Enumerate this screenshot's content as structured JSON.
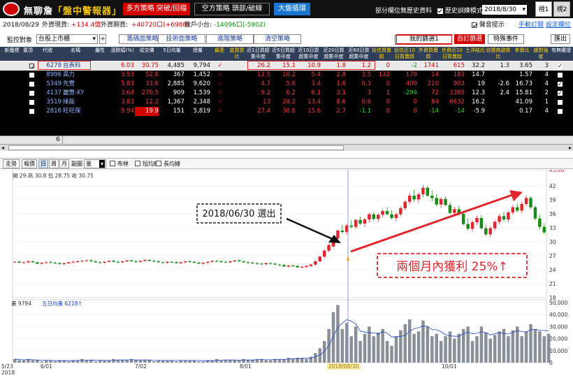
{
  "titlebar": {
    "app_name": "無聊詹",
    "app_subtitle": "「盤中警報器」",
    "btn_long": "多方策略 突破/回檔",
    "btn_short": "空方策略 頭部/破線",
    "btn_cycle": "大盤循環",
    "opt_store": "部分欄位無歷史資料",
    "opt_history": "歷史訓練模式",
    "date": "2018/8/30",
    "window1": "視1",
    "window2": "視2"
  },
  "infobar": {
    "date": "2018/08/29",
    "fx_spot_label": "外資現貨:",
    "fx_spot_value": "+134.4億",
    "fx_futures_label": "外資期貨:",
    "fx_futures_value": "+40720口(+6988)",
    "retail_label": "散戶小台:",
    "retail_value": "-14096口(-5902)",
    "opt_sound": "聲音提示",
    "link_manual": "手動訂閱",
    "link_settings": "設定欄位"
  },
  "toolbar2": {
    "monitor_label": "監控對象",
    "monitor_value": "台股上市櫃",
    "btn_chip": "籌碼面策略",
    "btn_tech": "技術面策略",
    "btn_advanced": "進階策略",
    "btn_clear": "清空策略",
    "my_screen": "我的篩選1",
    "custom_screen": "自訂篩選",
    "special_event": "特殊事件",
    "export": "匯出"
  },
  "table": {
    "headers": [
      "新獲標",
      "置頂",
      "代號",
      "名稱",
      "屬性",
      "漲跌幅(%)",
      "成交價",
      "5日均量",
      "總量",
      "最愛",
      "當買買比",
      "近1日買超集中度",
      "近5日買超集中度",
      "近10日買超集中度",
      "近20日買超集中度",
      "近60日買超集中度",
      "投信買賣超",
      "投信近10日買賣超",
      "外資買賣超",
      "外資近10日買賣超",
      "土洋結比",
      "自營商避險比",
      "參賣比",
      "趨勢強度",
      "有無權證"
    ],
    "rows": [
      {
        "code": "6278",
        "name": "台表科",
        "chg": "6.03",
        "price": "30.75",
        "vol5": "4,485",
        "vol": "9,794",
        "c1": "26.2",
        "c5": "15.1",
        "c10": "10.9",
        "c20": "1.8",
        "c60": "1.2",
        "it": "0",
        "it10": "-2",
        "fi": "1741",
        "fi10": "615",
        "ratio": "32.2",
        "hedge": "1.3",
        "sell": "3.65",
        "trend": "3",
        "warrant": true,
        "checked": true
      },
      {
        "code": "8996",
        "name": "高力",
        "chg": "3.53",
        "price": "52.8",
        "vol5": "367",
        "vol": "1,452",
        "c1": "11.5",
        "c5": "10.2",
        "c10": "5.4",
        "c20": "2.8",
        "c60": "3.5",
        "it": "132",
        "it10": "179",
        "fi": "14",
        "fi10": "183",
        "ratio": "14.7",
        "hedge": "",
        "sell": "1.57",
        "trend": "4",
        "warrant": false,
        "checked": false
      },
      {
        "code": "5349",
        "name": "先豐",
        "chg": "5.83",
        "price": "33.6",
        "vol5": "2,885",
        "vol": "9,620",
        "c1": "4.7",
        "c5": "5.6",
        "c10": "3.4",
        "c20": "1.6",
        "c60": "0.3",
        "it": "0",
        "it10": "409",
        "fi": "210",
        "fi10": "903",
        "ratio": "19",
        "hedge": "-2.6",
        "sell": "16.73",
        "trend": "4",
        "warrant": true,
        "checked": false
      },
      {
        "code": "4137",
        "name": "麗豐-KY",
        "chg": "3.64",
        "price": "270.5",
        "vol5": "909",
        "vol": "1,539",
        "c1": "9.2",
        "c5": "6.2",
        "c10": "6.1",
        "c20": "3.1",
        "c60": "3",
        "it": "1",
        "it10": "-294",
        "fi": "72",
        "fi10": "1385",
        "ratio": "12.3",
        "hedge": "2.4",
        "sell": "15.81",
        "trend": "2",
        "warrant": true,
        "checked": false
      },
      {
        "code": "3519",
        "name": "綠能",
        "chg": "3.83",
        "price": "12.2",
        "vol5": "1,367",
        "vol": "2,348",
        "c1": "13",
        "c5": "28.2",
        "c10": "13.4",
        "c20": "8.6",
        "c60": "0.6",
        "it": "0",
        "it10": "0",
        "fi": "84",
        "fi10": "6632",
        "ratio": "16.2",
        "hedge": "",
        "sell": "41.09",
        "trend": "1",
        "warrant": false,
        "checked": false
      },
      {
        "code": "2816",
        "name": "旺旺保",
        "chg": "9.94",
        "price": "19.9",
        "vol5": "151",
        "vol": "5,819",
        "c1": "27.4",
        "c5": "30.6",
        "c10": "15.6",
        "c20": "2.7",
        "c60": "-1.1",
        "it": "0",
        "it10": "0",
        "fi": "-14",
        "fi10": "-14",
        "ratio": "-5.9",
        "hedge": "",
        "sell": "0.17",
        "trend": "4",
        "warrant": false,
        "checked": false
      }
    ],
    "status_count": "6"
  },
  "chart_toolbar": {
    "tabs": [
      "走勢",
      "報價",
      "日",
      "周",
      "月"
    ],
    "sub_label": "副圖",
    "sub_value": "量",
    "opt_bollinger": "布林",
    "opt_short_ma": "短均線",
    "opt_long_ma": "長均線"
  },
  "chart_info": {
    "ohlc": "開 29 高 30.8 低 28.75 收 30.75",
    "vol_label": "量 9794",
    "vol_ma_label": "五日均量 6218↑"
  },
  "annotations": {
    "pick_label": "2018/06/30 選出",
    "profit_label": "兩個月內獲利 25%↑",
    "marker_date": "2018/08/30"
  },
  "chart_data": {
    "type": "candlestick",
    "price_axis": [
      18,
      21,
      24,
      27,
      30,
      33,
      36,
      39,
      42,
      45.46
    ],
    "volume_axis": [
      "0",
      "10,000",
      "20,000",
      "30,000",
      "40,000",
      "50,000"
    ],
    "x_labels": [
      "5/23\n2018",
      "6/01",
      "7/02",
      "8/01",
      "2018/08/30",
      "10/01"
    ],
    "max_price_label": "45.46",
    "candles": [
      [
        25.6,
        25.8,
        25.5,
        25.7
      ],
      [
        25.7,
        25.9,
        25.4,
        25.5
      ],
      [
        25.5,
        25.8,
        25.3,
        25.6
      ],
      [
        25.6,
        26.0,
        25.4,
        25.8
      ],
      [
        25.8,
        26.0,
        25.5,
        25.6
      ],
      [
        25.6,
        25.7,
        25.2,
        25.3
      ],
      [
        25.3,
        25.6,
        25.1,
        25.5
      ],
      [
        25.5,
        25.8,
        25.3,
        25.6
      ],
      [
        25.6,
        25.9,
        25.4,
        25.5
      ],
      [
        25.5,
        25.7,
        25.2,
        25.4
      ],
      [
        25.4,
        25.6,
        25.1,
        25.2
      ],
      [
        25.2,
        25.5,
        25.0,
        25.4
      ],
      [
        25.4,
        25.7,
        25.2,
        25.6
      ],
      [
        25.6,
        25.9,
        25.4,
        25.7
      ],
      [
        25.7,
        26.0,
        25.5,
        25.8
      ],
      [
        25.8,
        26.1,
        25.6,
        25.9
      ],
      [
        25.9,
        26.2,
        25.7,
        26.0
      ],
      [
        26.0,
        26.3,
        25.7,
        25.8
      ],
      [
        25.8,
        26.0,
        25.5,
        25.6
      ],
      [
        25.6,
        25.8,
        25.3,
        25.5
      ],
      [
        25.5,
        25.8,
        25.3,
        25.7
      ],
      [
        25.7,
        26.0,
        25.5,
        25.9
      ],
      [
        25.9,
        26.1,
        25.6,
        25.7
      ],
      [
        25.7,
        25.9,
        25.4,
        25.6
      ],
      [
        25.6,
        25.9,
        25.4,
        25.8
      ],
      [
        25.8,
        26.1,
        25.6,
        26.0
      ],
      [
        26.0,
        26.2,
        25.7,
        25.8
      ],
      [
        25.8,
        26.0,
        25.5,
        25.7
      ],
      [
        25.7,
        26.0,
        25.5,
        25.9
      ],
      [
        25.9,
        26.2,
        25.7,
        26.1
      ],
      [
        26.1,
        26.3,
        25.8,
        25.9
      ],
      [
        25.9,
        26.1,
        25.6,
        25.8
      ],
      [
        25.8,
        26.0,
        25.5,
        25.6
      ],
      [
        25.6,
        25.8,
        25.3,
        25.5
      ],
      [
        25.5,
        25.8,
        25.3,
        25.7
      ],
      [
        25.7,
        25.9,
        25.4,
        25.6
      ],
      [
        25.6,
        25.8,
        25.3,
        25.4
      ],
      [
        25.4,
        25.7,
        25.2,
        25.6
      ],
      [
        25.6,
        25.9,
        25.4,
        25.8
      ],
      [
        25.8,
        26.0,
        25.5,
        25.7
      ],
      [
        25.7,
        25.9,
        25.4,
        25.5
      ],
      [
        25.5,
        25.7,
        25.2,
        25.3
      ],
      [
        25.3,
        25.6,
        25.1,
        25.5
      ],
      [
        25.5,
        25.8,
        25.3,
        25.7
      ],
      [
        25.7,
        26.0,
        25.5,
        25.9
      ],
      [
        25.9,
        26.1,
        25.6,
        25.8
      ],
      [
        25.8,
        26.0,
        25.5,
        25.7
      ],
      [
        25.7,
        25.9,
        25.4,
        25.6
      ],
      [
        25.6,
        25.9,
        25.4,
        25.8
      ],
      [
        25.8,
        26.1,
        25.6,
        26.0
      ],
      [
        26.0,
        26.2,
        25.7,
        25.8
      ],
      [
        25.8,
        26.0,
        25.5,
        25.6
      ],
      [
        25.6,
        25.8,
        25.3,
        25.5
      ],
      [
        25.5,
        25.7,
        25.2,
        25.4
      ],
      [
        25.4,
        25.6,
        25.1,
        25.3
      ],
      [
        25.3,
        25.5,
        25.0,
        25.2
      ],
      [
        25.2,
        25.5,
        25.0,
        25.4
      ],
      [
        25.4,
        25.6,
        25.1,
        25.3
      ],
      [
        25.3,
        25.5,
        25.0,
        25.1
      ],
      [
        25.1,
        25.3,
        24.8,
        25.0
      ],
      [
        25.0,
        25.2,
        24.6,
        24.7
      ],
      [
        24.7,
        25.0,
        24.5,
        24.9
      ],
      [
        24.9,
        25.1,
        24.6,
        24.8
      ],
      [
        24.8,
        25.0,
        24.4,
        24.5
      ],
      [
        24.5,
        24.8,
        24.3,
        24.6
      ],
      [
        24.6,
        24.9,
        24.4,
        24.8
      ],
      [
        24.8,
        25.3,
        24.6,
        25.1
      ],
      [
        25.1,
        26.0,
        24.9,
        25.8
      ],
      [
        25.8,
        27.0,
        25.6,
        26.8
      ],
      [
        26.8,
        28.3,
        26.5,
        28.1
      ],
      [
        28.1,
        29.5,
        27.8,
        29.3
      ],
      [
        29.0,
        30.8,
        28.75,
        30.75
      ],
      [
        30.7,
        32.6,
        30.4,
        32.4
      ],
      [
        32.4,
        33.6,
        31.8,
        32.1
      ],
      [
        32.1,
        33.8,
        31.6,
        33.5
      ],
      [
        33.5,
        34.6,
        32.9,
        33.2
      ],
      [
        33.2,
        34.9,
        32.8,
        34.7
      ],
      [
        34.7,
        35.4,
        33.6,
        33.9
      ],
      [
        33.9,
        35.1,
        33.2,
        34.8
      ],
      [
        34.8,
        36.2,
        34.2,
        35.9
      ],
      [
        35.9,
        36.4,
        34.5,
        34.9
      ],
      [
        34.9,
        36.1,
        34.3,
        35.8
      ],
      [
        35.8,
        37.0,
        35.2,
        36.6
      ],
      [
        36.6,
        37.4,
        35.7,
        35.9
      ],
      [
        35.9,
        36.8,
        34.8,
        35.1
      ],
      [
        35.1,
        36.3,
        34.4,
        35.9
      ],
      [
        35.9,
        37.6,
        35.5,
        37.2
      ],
      [
        37.2,
        38.9,
        36.8,
        38.6
      ],
      [
        38.6,
        40.4,
        38.0,
        39.9
      ],
      [
        39.9,
        41.2,
        38.6,
        39.1
      ],
      [
        39.1,
        40.6,
        38.3,
        40.2
      ],
      [
        40.2,
        42.2,
        39.6,
        41.6
      ],
      [
        41.6,
        42.0,
        39.5,
        39.9
      ],
      [
        39.9,
        41.0,
        38.7,
        39.4
      ],
      [
        39.4,
        40.2,
        37.6,
        38.0
      ],
      [
        38.0,
        39.6,
        37.2,
        39.2
      ],
      [
        39.2,
        39.8,
        37.6,
        37.9
      ],
      [
        37.9,
        38.6,
        35.9,
        36.2
      ],
      [
        36.2,
        37.5,
        35.4,
        37.0
      ],
      [
        37.0,
        37.8,
        35.6,
        36.0
      ],
      [
        36.0,
        36.6,
        33.5,
        33.8
      ],
      [
        33.8,
        35.0,
        32.4,
        32.8
      ],
      [
        32.8,
        34.6,
        32.2,
        34.2
      ],
      [
        34.2,
        35.6,
        33.6,
        35.1
      ],
      [
        35.1,
        35.8,
        32.6,
        32.9
      ],
      [
        32.9,
        33.6,
        31.2,
        31.6
      ],
      [
        31.6,
        33.4,
        31.0,
        32.9
      ],
      [
        32.9,
        34.6,
        32.4,
        34.3
      ],
      [
        34.3,
        35.9,
        33.8,
        35.5
      ],
      [
        35.5,
        36.4,
        34.3,
        34.8
      ],
      [
        34.8,
        36.6,
        34.2,
        36.3
      ],
      [
        36.3,
        37.9,
        35.8,
        37.4
      ],
      [
        37.4,
        38.2,
        36.3,
        36.7
      ],
      [
        36.7,
        38.6,
        36.2,
        38.1
      ],
      [
        38.1,
        40.0,
        37.6,
        39.4
      ],
      [
        39.4,
        39.8,
        37.0,
        37.4
      ],
      [
        37.4,
        37.9,
        34.6,
        35.0
      ],
      [
        35.0,
        35.8,
        32.6,
        33.2
      ],
      [
        33.2,
        34.0,
        31.6,
        32.0
      ]
    ],
    "volumes": [
      3,
      2,
      2,
      3,
      2,
      2,
      1,
      2,
      2,
      1,
      2,
      2,
      1,
      2,
      2,
      3,
      2,
      2,
      1,
      2,
      2,
      2,
      3,
      2,
      2,
      2,
      3,
      2,
      2,
      2,
      2,
      1,
      2,
      2,
      2,
      2,
      1,
      2,
      2,
      2,
      2,
      1,
      1,
      2,
      2,
      3,
      2,
      2,
      2,
      2,
      2,
      3,
      2,
      2,
      3,
      3,
      2,
      2,
      3,
      3,
      3,
      4,
      3,
      4,
      4,
      3,
      5,
      8,
      12,
      18,
      28,
      42,
      48,
      28,
      33,
      22,
      30,
      18,
      24,
      30,
      22,
      25,
      28,
      18,
      14,
      22,
      27,
      32,
      36,
      24,
      26,
      35,
      30,
      22,
      24,
      18,
      22,
      26,
      20,
      24,
      28,
      30,
      18,
      22,
      30,
      25,
      20,
      23,
      26,
      28,
      22,
      27,
      30,
      22,
      26,
      32,
      28,
      26,
      22,
      24
    ],
    "volume_unit_max": 50
  }
}
